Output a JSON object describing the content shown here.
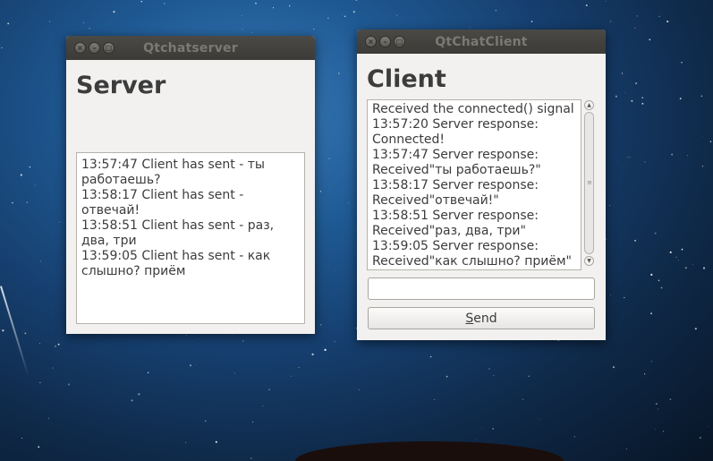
{
  "server_window": {
    "title": "Qtchatserver",
    "heading": "Server",
    "log_lines": [
      "13:57:47 Client has sent - ты работаешь?",
      "13:58:17 Client has sent - отвечай!",
      "13:58:51 Client has sent - раз, два, три",
      "13:59:05 Client has sent - как слышно? приём"
    ]
  },
  "client_window": {
    "title": "QtChatClient",
    "heading": "Client",
    "log_lines": [
      "Received the connected() signal",
      "13:57:20 Server response: Connected!",
      "13:57:47 Server response: Received\"ты работаешь?\"",
      "13:58:17 Server response: Received\"отвечай!\"",
      "13:58:51 Server response: Received\"раз, два, три\"",
      "13:59:05 Server response: Received\"как слышно? приём\""
    ],
    "message_input": {
      "value": "",
      "placeholder": ""
    },
    "send_button": {
      "mnemonic": "S",
      "rest": "end"
    }
  },
  "colors": {
    "titlebar": "#3c3b37",
    "window_bg": "#f2f1f0",
    "text": "#3c3c3c",
    "title_text": "#7a7973"
  },
  "icons": [
    "close-icon",
    "minimize-icon",
    "maximize-icon",
    "scroll-up-icon",
    "scroll-down-icon",
    "scroll-grip-icon"
  ]
}
